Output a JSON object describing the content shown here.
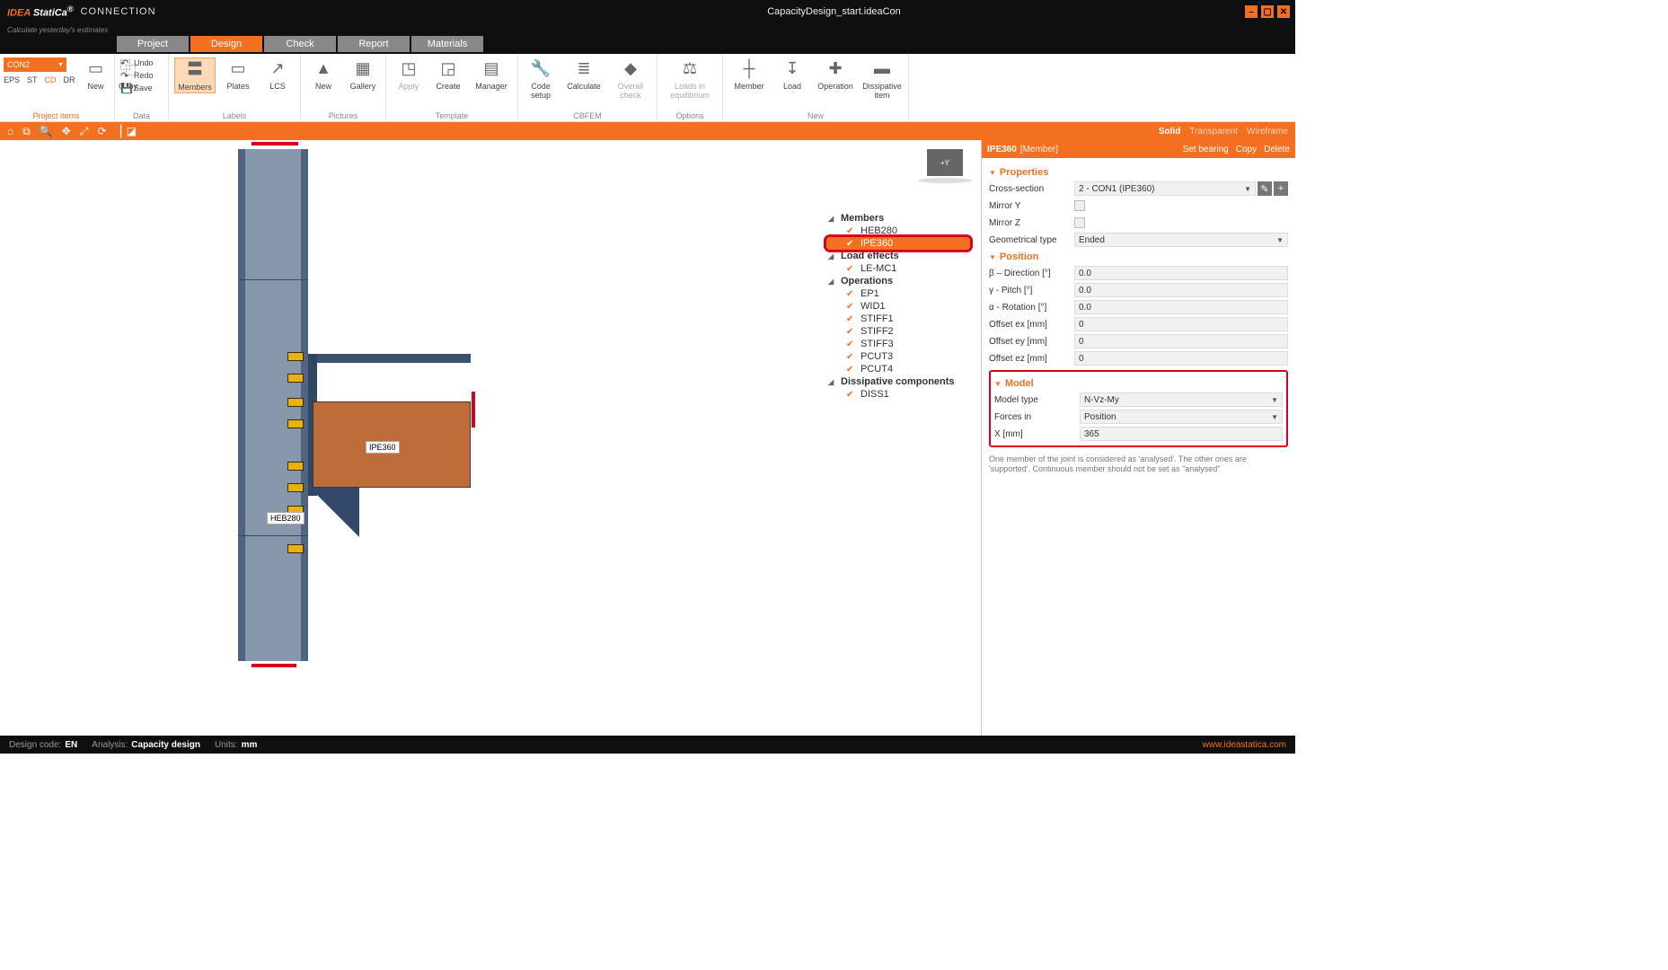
{
  "titlebar": {
    "logo_pre": "IDEA",
    "logo_post": "StatiCa",
    "product": "CONNECTION",
    "tagline": "Calculate yesterday's estimates",
    "document": "CapacityDesign_start.ideaCon"
  },
  "tabs": [
    "Project",
    "Design",
    "Check",
    "Report",
    "Materials"
  ],
  "active_tab": "Design",
  "ribbon": {
    "project": {
      "dropdown": "CON2",
      "mini": [
        "EPS",
        "ST",
        "CD",
        "DR"
      ],
      "btnNew": "New",
      "btnCopy": "Copy",
      "group": "Project items"
    },
    "data": {
      "undo": "Undo",
      "redo": "Redo",
      "save": "Save",
      "group": "Data"
    },
    "labels": {
      "members": "Members",
      "plates": "Plates",
      "lcs": "LCS",
      "group": "Labels"
    },
    "pictures": {
      "new": "New",
      "gallery": "Gallery",
      "group": "Pictures"
    },
    "template": {
      "apply": "Apply",
      "create": "Create",
      "manager": "Manager",
      "group": "Template"
    },
    "cbfem": {
      "code": "Code setup",
      "calc": "Calculate",
      "overall": "Overall check",
      "group": "CBFEM"
    },
    "options": {
      "loads": "Loads in equilibrium",
      "group": "Options"
    },
    "new": {
      "member": "Member",
      "load": "Load",
      "operation": "Operation",
      "diss": "Dissipative item",
      "group": "New"
    }
  },
  "viewbar": {
    "opts": [
      "Solid",
      "Transparent",
      "Wireframe"
    ],
    "sel": "Solid"
  },
  "tree": [
    {
      "type": "h",
      "label": "Members"
    },
    {
      "type": "i",
      "label": "HEB280"
    },
    {
      "type": "i",
      "label": "IPE360",
      "sel": true,
      "hl": true
    },
    {
      "type": "h",
      "label": "Load effects"
    },
    {
      "type": "i",
      "label": "LE-MC1"
    },
    {
      "type": "h",
      "label": "Operations"
    },
    {
      "type": "i",
      "label": "EP1"
    },
    {
      "type": "i",
      "label": "WID1"
    },
    {
      "type": "i",
      "label": "STIFF1"
    },
    {
      "type": "i",
      "label": "STIFF2"
    },
    {
      "type": "i",
      "label": "STIFF3"
    },
    {
      "type": "i",
      "label": "PCUT3"
    },
    {
      "type": "i",
      "label": "PCUT4"
    },
    {
      "type": "h",
      "label": "Dissipative components"
    },
    {
      "type": "i",
      "label": "DISS1"
    }
  ],
  "canvas": {
    "beam_label": "IPE360",
    "col_label": "HEB280",
    "navcube": "+Y"
  },
  "panel": {
    "title": "IPE360",
    "subtitle": "[Member]",
    "actions": [
      "Set bearing",
      "Copy",
      "Delete"
    ],
    "properties": {
      "header": "Properties",
      "cross_section_label": "Cross-section",
      "cross_section": "2 - CON1 (IPE360)",
      "mirrorY_label": "Mirror Y",
      "mirrorZ_label": "Mirror Z",
      "geom_label": "Geometrical type",
      "geom": "Ended"
    },
    "position": {
      "header": "Position",
      "rows": [
        {
          "l": "β – Direction [°]",
          "v": "0.0"
        },
        {
          "l": "γ - Pitch [°]",
          "v": "0.0"
        },
        {
          "l": "α - Rotation [°]",
          "v": "0.0"
        },
        {
          "l": "Offset ex [mm]",
          "v": "0"
        },
        {
          "l": "Offset ey [mm]",
          "v": "0"
        },
        {
          "l": "Offset ez [mm]",
          "v": "0"
        }
      ]
    },
    "model": {
      "header": "Model",
      "model_type_label": "Model type",
      "model_type": "N-Vz-My",
      "forces_label": "Forces in",
      "forces": "Position",
      "x_label": "X [mm]",
      "x": "365"
    },
    "note": "One member of the joint is considered as 'analysed'. The other ones are 'supported'. Continuous member should not be set as \"analysed\""
  },
  "status": {
    "code_l": "Design code:",
    "code": "EN",
    "analysis_l": "Analysis:",
    "analysis": "Capacity design",
    "units_l": "Units:",
    "units": "mm",
    "site": "www.ideastatica.com"
  }
}
